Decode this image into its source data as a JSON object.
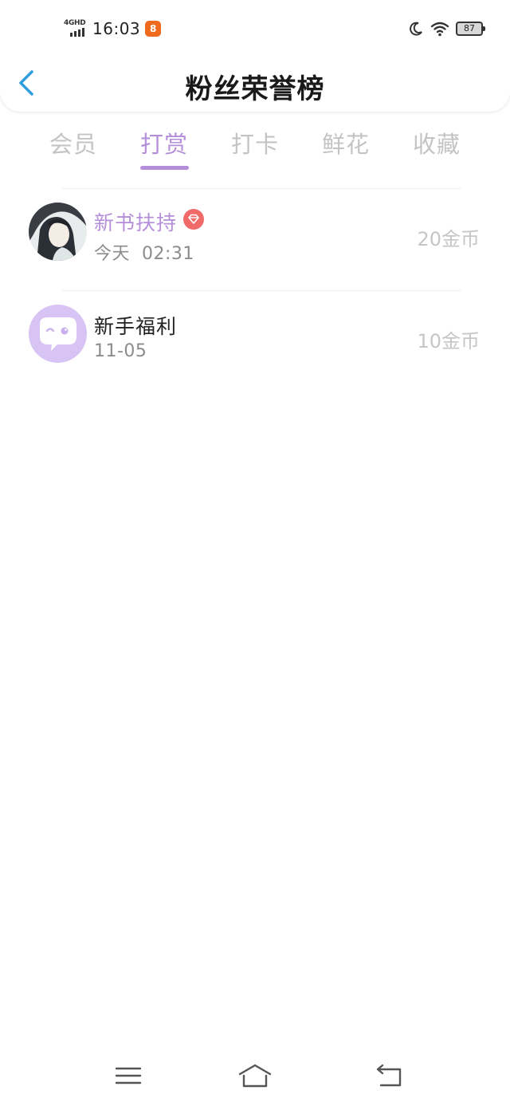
{
  "status_bar": {
    "network": "4GHD",
    "time": "16:03",
    "app_badge": "8",
    "battery": "87",
    "icons": [
      "moon-icon",
      "wifi-icon",
      "battery-icon"
    ]
  },
  "header": {
    "title": "粉丝荣誉榜",
    "back_icon": "chevron-left-icon"
  },
  "tabs": [
    {
      "label": "会员",
      "active": false
    },
    {
      "label": "打赏",
      "active": true
    },
    {
      "label": "打卡",
      "active": false
    },
    {
      "label": "鲜花",
      "active": false
    },
    {
      "label": "收藏",
      "active": false
    }
  ],
  "list": [
    {
      "name": "新书扶持",
      "badge_icon": "diamond-icon",
      "time": "今天  02:31",
      "amount": "20金币",
      "avatar": "avatar-illustration"
    },
    {
      "name": "新手福利",
      "time": "11-05",
      "amount": "10金币",
      "avatar": "chat-bubble-icon"
    }
  ],
  "colors": {
    "accent": "#b58ed9",
    "back_arrow": "#2f9fe2",
    "badge_red": "#f06a6a",
    "muted": "#c4c4c4"
  },
  "nav_bar": {
    "icons": [
      "menu-icon",
      "home-icon",
      "back-icon"
    ]
  }
}
